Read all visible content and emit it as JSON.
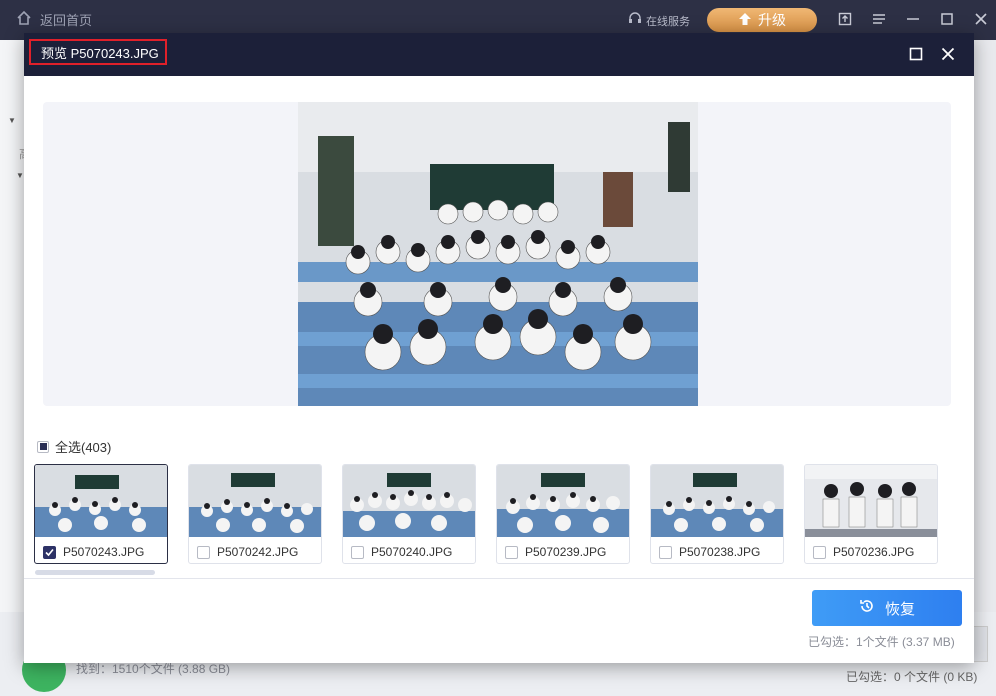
{
  "app": {
    "back_home": "返回首页",
    "online_service": "在线服务",
    "upgrade": "升级",
    "found_text": "找到：1510个文件 (3.88 GB)",
    "selected_text": "已勾选：0 个文件 (0 KB)",
    "sidebar_char": "高"
  },
  "dialog": {
    "title": "预览 P5070243.JPG",
    "select_all": "全选(403)",
    "recover_label": "恢复",
    "selected_info": "已勾选：1个文件 (3.37 MB)",
    "thumbnails": [
      {
        "name": "P5070243.JPG",
        "checked": true
      },
      {
        "name": "P5070242.JPG",
        "checked": false
      },
      {
        "name": "P5070240.JPG",
        "checked": false
      },
      {
        "name": "P5070239.JPG",
        "checked": false
      },
      {
        "name": "P5070238.JPG",
        "checked": false
      },
      {
        "name": "P5070236.JPG",
        "checked": false
      }
    ]
  },
  "colors": {
    "titlebar": "#2d3045",
    "dialog_header": "#1c2039",
    "accent_blue": "#3f9cf6",
    "upgrade_orange": "#e1a159",
    "highlight_red": "#e0202a"
  }
}
